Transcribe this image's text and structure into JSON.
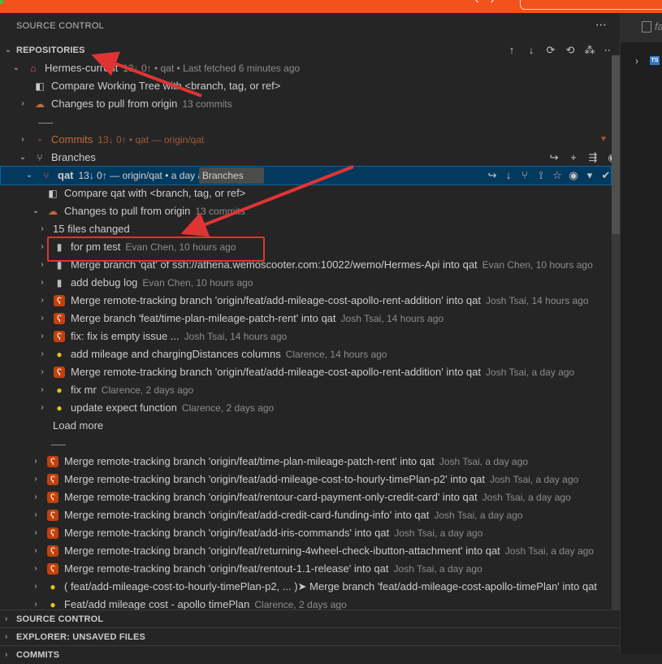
{
  "panel": {
    "title": "SOURCE CONTROL",
    "more": "⋯"
  },
  "repositories": {
    "header": "REPOSITORIES",
    "actions": [
      "↑",
      "↓",
      "⟳",
      "⟲",
      "⁂",
      "⋯"
    ]
  },
  "repo": {
    "name": "Hermes-current",
    "meta": "13↓ 0↑ • qat • Last fetched 6 minutes ago",
    "compare": "Compare Working Tree with <branch, tag, or ref>",
    "changes": "Changes to pull from origin",
    "changes_meta": "13 commits",
    "sep": "──",
    "commits_label": "Commits",
    "commits_meta": "13↓ 0↑ • qat — origin/qat"
  },
  "branches": {
    "label": "Branches",
    "actions": [
      "↪",
      "+",
      "⇶",
      "◉"
    ],
    "selected": {
      "name": "qat",
      "meta": "13↓ 0↑ — origin/qat • a day ago",
      "actions": [
        "↪",
        "↓",
        "⑂",
        "⟟",
        "☆",
        "◉",
        "▾",
        "✔"
      ]
    },
    "tooltip": "Branches",
    "compare": "Compare qat with <branch, tag, or ref>",
    "changes": "Changes to pull from origin",
    "changes_meta": "13 commits",
    "files_changed": "15 files changed"
  },
  "commits": [
    {
      "msg": "for pm test",
      "meta": "Evan Chen, 10 hours ago",
      "avatar": "cmt"
    },
    {
      "msg": "Merge branch 'qat' of ssh://athena.wemoscooter.com:10022/wemo/Hermes-Api into qat",
      "meta": "Evan Chen, 10 hours ago",
      "avatar": "cmt"
    },
    {
      "msg": "add debug log",
      "meta": "Evan Chen, 10 hours ago",
      "avatar": "cmt"
    },
    {
      "msg": "Merge remote-tracking branch 'origin/feat/add-mileage-cost-apollo-rent-addition' into qat",
      "meta": "Josh Tsai, 14 hours ago",
      "avatar": "bear"
    },
    {
      "msg": "Merge branch 'feat/time-plan-mileage-patch-rent' into qat",
      "meta": "Josh Tsai, 14 hours ago",
      "avatar": "bear"
    },
    {
      "msg": "fix: fix is empty issue ...",
      "meta": "Josh Tsai, 14 hours ago",
      "avatar": "bear"
    },
    {
      "msg": "add mileage and chargingDistances columns",
      "meta": "Clarence, 14 hours ago",
      "avatar": "bulb"
    },
    {
      "msg": "Merge remote-tracking branch 'origin/feat/add-mileage-cost-apollo-rent-addition' into qat",
      "meta": "Josh Tsai, a day ago",
      "avatar": "bear"
    },
    {
      "msg": "fix mr",
      "meta": "Clarence, 2 days ago",
      "avatar": "bulb"
    },
    {
      "msg": "update expect function",
      "meta": "Clarence, 2 days ago",
      "avatar": "bulb"
    }
  ],
  "load_more": "Load more",
  "outer_commits": [
    {
      "msg": "Merge remote-tracking branch 'origin/feat/time-plan-mileage-patch-rent' into qat",
      "meta": "Josh Tsai, a day ago",
      "avatar": "bear"
    },
    {
      "msg": "Merge remote-tracking branch 'origin/feat/add-mileage-cost-to-hourly-timePlan-p2' into qat",
      "meta": "Josh Tsai, a day ago",
      "avatar": "bear"
    },
    {
      "msg": "Merge remote-tracking branch 'origin/feat/rentour-card-payment-only-credit-card' into qat",
      "meta": "Josh Tsai, a day ago",
      "avatar": "bear"
    },
    {
      "msg": "Merge remote-tracking branch 'origin/feat/add-credit-card-funding-info' into qat",
      "meta": "Josh Tsai, a day ago",
      "avatar": "bear"
    },
    {
      "msg": "Merge remote-tracking branch 'origin/feat/add-iris-commands' into qat",
      "meta": "Josh Tsai, a day ago",
      "avatar": "bear"
    },
    {
      "msg": "Merge remote-tracking branch 'origin/feat/returning-4wheel-check-ibutton-attachment' into qat",
      "meta": "Josh Tsai, a day ago",
      "avatar": "bear"
    },
    {
      "msg": "Merge remote-tracking branch 'origin/feat/rentout-1.1-release' into qat",
      "meta": "Josh Tsai, a day ago",
      "avatar": "bear"
    },
    {
      "msg": "( feat/add-mileage-cost-to-hourly-timePlan-p2, ... )➤  Merge branch 'feat/add-mileage-cost-apollo-timePlan' into qat",
      "meta": "",
      "avatar": "bulb"
    },
    {
      "msg": "Feat/add mileage cost - apollo timePlan",
      "meta": "Clarence, 2 days ago",
      "avatar": "bulb"
    }
  ],
  "bottom_sections": [
    "SOURCE CONTROL",
    "EXPLORER: UNSAVED FILES",
    "COMMITS"
  ],
  "right_pane": {
    "tab_label": "fa",
    "ts_badge": "TS"
  },
  "colors": {
    "accent_topbar": "#f2521d",
    "selection": "#04395e",
    "annotation_red": "#e03434"
  }
}
